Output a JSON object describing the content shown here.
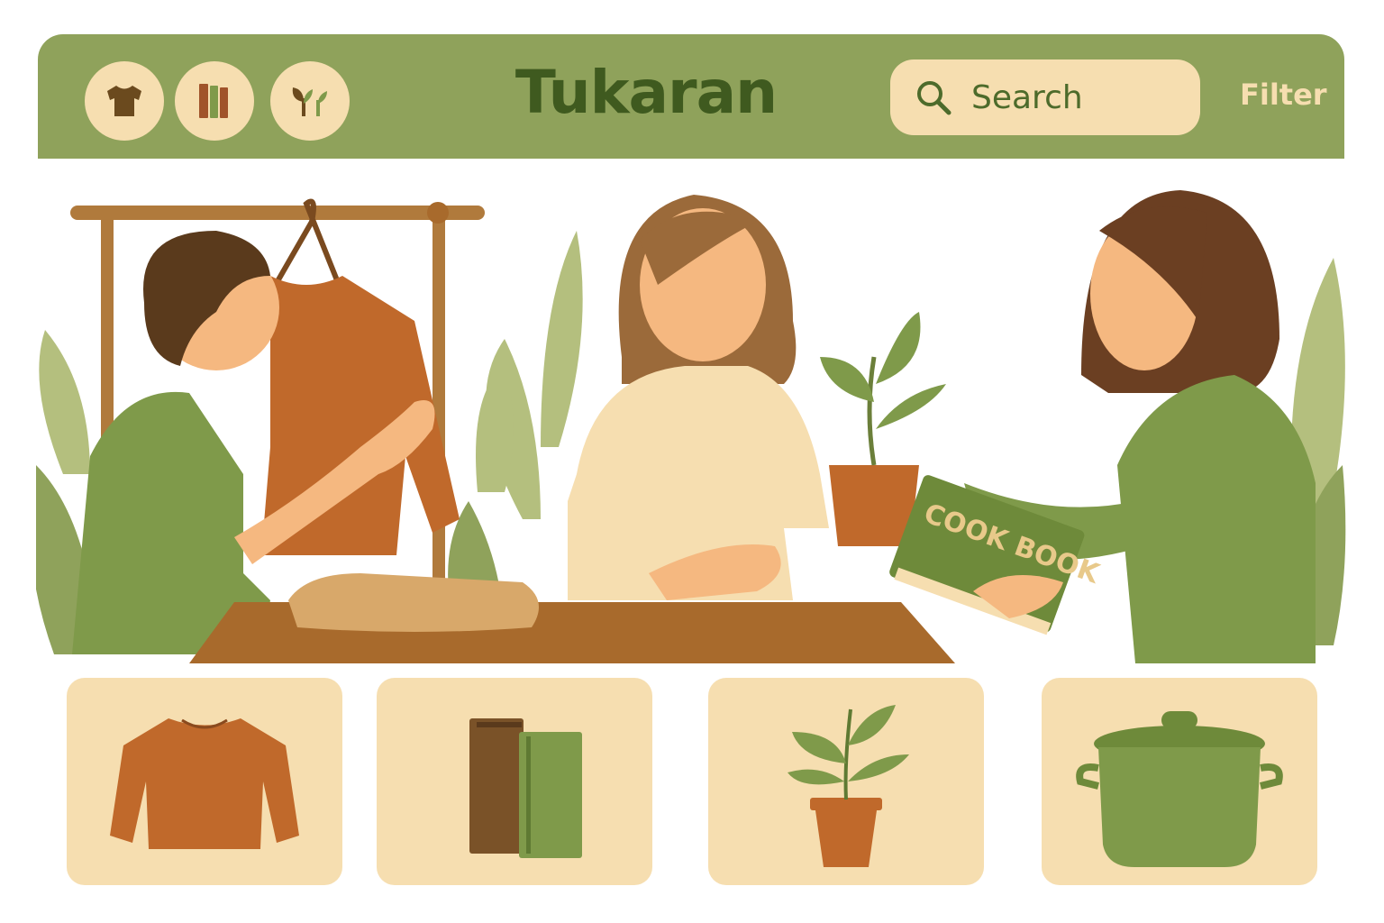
{
  "app": {
    "title": "Tukaran"
  },
  "nav": {
    "categories": [
      {
        "icon": "shirt-icon",
        "name": "clothing"
      },
      {
        "icon": "books-icon",
        "name": "books"
      },
      {
        "icon": "plants-icon",
        "name": "plants"
      }
    ]
  },
  "search": {
    "placeholder": "Search"
  },
  "filter": {
    "label": "Filter"
  },
  "hero": {
    "book_text": "COOK BOOK"
  },
  "items": [
    {
      "icon": "sweater-icon"
    },
    {
      "icon": "books-icon"
    },
    {
      "icon": "potted-plant-icon"
    },
    {
      "icon": "cooking-pot-icon"
    }
  ],
  "colors": {
    "header_green": "#8fa25b",
    "brand_text": "#3f5a1f",
    "cream": "#f6deb0",
    "rust": "#c0692b",
    "leaf_green": "#7f9a4a",
    "wood": "#a86a2c"
  }
}
